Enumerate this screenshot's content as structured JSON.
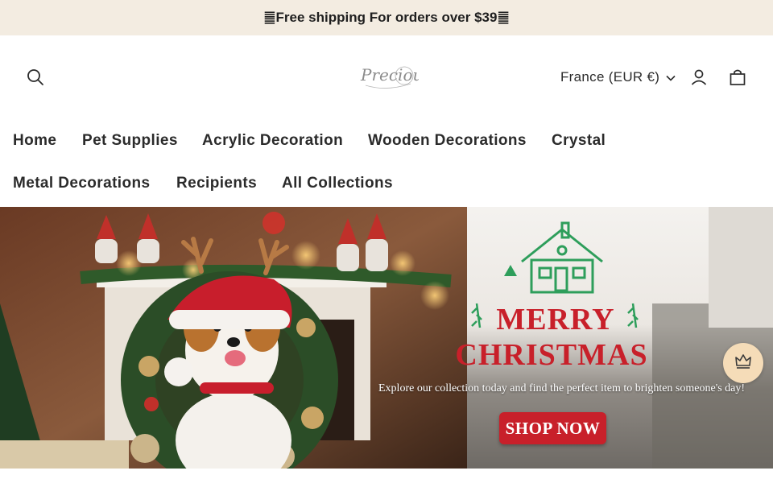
{
  "announcement": {
    "text": "䷀Free shipping For orders over $39䷀"
  },
  "header": {
    "logo_text": "Precious",
    "locale_label": "France (EUR €)",
    "icons": {
      "search": "search-icon",
      "account": "user-icon",
      "cart": "bag-icon",
      "locale_caret": "chevron-down-icon"
    }
  },
  "nav": {
    "items": [
      {
        "label": "Home"
      },
      {
        "label": "Pet Supplies"
      },
      {
        "label": "Acrylic Decoration"
      },
      {
        "label": "Wooden Decorations"
      },
      {
        "label": "Crystal"
      },
      {
        "label": "Metal Decorations"
      },
      {
        "label": "Recipients"
      },
      {
        "label": "All Collections"
      }
    ]
  },
  "hero": {
    "title_line1": "MERRY",
    "title_line2": "CHRISTMAS",
    "tagline": "Explore our collection today and find the perfect item to brighten someone's day!",
    "cta_label": "SHOP NOW"
  },
  "floating": {
    "icon": "crown-icon"
  },
  "colors": {
    "announcement_bg": "#f3ece1",
    "accent_red": "#c8202a",
    "floating_bg": "#f5dcb8",
    "house_green": "#2e9e5b"
  }
}
